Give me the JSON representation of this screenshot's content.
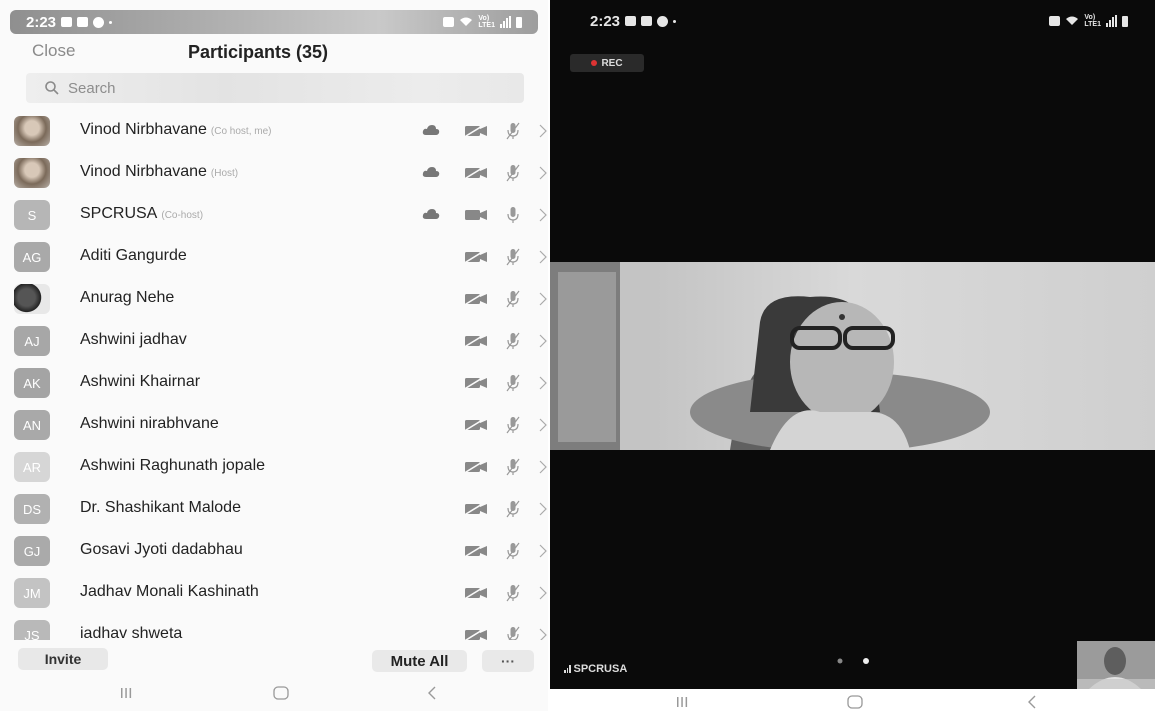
{
  "left_phone": {
    "status_bar": {
      "time": "2:23",
      "net_small_top": "Vo)",
      "net_small_bottom": "LTE1"
    },
    "header": {
      "close_label": "Close",
      "title": "Participants (35)"
    },
    "search": {
      "placeholder": "Search"
    },
    "participants": [
      {
        "name": "Vinod Nirbhavane",
        "role": "(Co host, me)",
        "avatar_initials": "",
        "avatar_type": "photo",
        "avatar_color": "#9a8a7a",
        "cloud": true,
        "cam_icon": "video-off-icon",
        "mic_icon": "mic-off-icon"
      },
      {
        "name": "Vinod Nirbhavane",
        "role": "(Host)",
        "avatar_initials": "",
        "avatar_type": "photo",
        "avatar_color": "#9a8a7a",
        "cloud": true,
        "cam_icon": "video-off-icon",
        "mic_icon": "mic-off-icon"
      },
      {
        "name": "SPCRUSA",
        "role": "(Co-host)",
        "avatar_initials": "S",
        "avatar_type": "initials",
        "avatar_color": "#b6b6b6",
        "cloud": true,
        "cam_icon": "video-icon",
        "mic_icon": "mic-icon"
      },
      {
        "name": "Aditi Gangurde",
        "role": "",
        "avatar_initials": "AG",
        "avatar_type": "initials",
        "avatar_color": "#a9a9a9",
        "cloud": false,
        "cam_icon": "video-off-icon",
        "mic_icon": "mic-off-icon"
      },
      {
        "name": "Anurag Nehe",
        "role": "",
        "avatar_initials": "",
        "avatar_type": "photo2",
        "avatar_color": "#333333",
        "cloud": false,
        "cam_icon": "video-off-icon",
        "mic_icon": "mic-off-icon"
      },
      {
        "name": "Ashwini jadhav",
        "role": "",
        "avatar_initials": "AJ",
        "avatar_type": "initials",
        "avatar_color": "#a7a7a7",
        "cloud": false,
        "cam_icon": "video-off-icon",
        "mic_icon": "mic-off-icon"
      },
      {
        "name": "Ashwini Khairnar",
        "role": "",
        "avatar_initials": "AK",
        "avatar_type": "initials",
        "avatar_color": "#a4a4a4",
        "cloud": false,
        "cam_icon": "video-off-icon",
        "mic_icon": "mic-off-icon"
      },
      {
        "name": "Ashwini nirabhvane",
        "role": "",
        "avatar_initials": "AN",
        "avatar_type": "initials",
        "avatar_color": "#a9a9a9",
        "cloud": false,
        "cam_icon": "video-off-icon",
        "mic_icon": "mic-off-icon"
      },
      {
        "name": "Ashwini Raghunath jopale",
        "role": "",
        "avatar_initials": "AR",
        "avatar_type": "initials",
        "avatar_color": "#d6d6d6",
        "cloud": false,
        "cam_icon": "video-off-icon",
        "mic_icon": "mic-off-icon"
      },
      {
        "name": "Dr. Shashikant Malode",
        "role": "",
        "avatar_initials": "DS",
        "avatar_type": "initials",
        "avatar_color": "#b1b1b1",
        "cloud": false,
        "cam_icon": "video-off-icon",
        "mic_icon": "mic-off-icon"
      },
      {
        "name": "Gosavi Jyoti dadabhau",
        "role": "",
        "avatar_initials": "GJ",
        "avatar_type": "initials",
        "avatar_color": "#aaaaaa",
        "cloud": false,
        "cam_icon": "video-off-icon",
        "mic_icon": "mic-off-icon"
      },
      {
        "name": "Jadhav Monali Kashinath",
        "role": "",
        "avatar_initials": "JM",
        "avatar_type": "initials",
        "avatar_color": "#c3c3c3",
        "cloud": false,
        "cam_icon": "video-off-icon",
        "mic_icon": "mic-off-icon"
      },
      {
        "name": "iadhav shweta",
        "role": "",
        "avatar_initials": "JS",
        "avatar_type": "initials",
        "avatar_color": "#b9b9b9",
        "cloud": false,
        "cam_icon": "video-off-icon",
        "mic_icon": "mic-off-icon"
      }
    ],
    "footer": {
      "invite_label": "Invite",
      "mute_all_label": "Mute All",
      "more_label": "···"
    }
  },
  "right_phone": {
    "status_bar": {
      "time": "2:23",
      "net_small_top": "Vo)",
      "net_small_bottom": "LTE1"
    },
    "rec_label": "REC",
    "active_speaker": "SPCRUSA",
    "page_indicator": {
      "pages": 2,
      "current": 2
    }
  },
  "colors": {
    "meeting_bg": "#0a0a0a",
    "rec_dot": "#d33333"
  }
}
